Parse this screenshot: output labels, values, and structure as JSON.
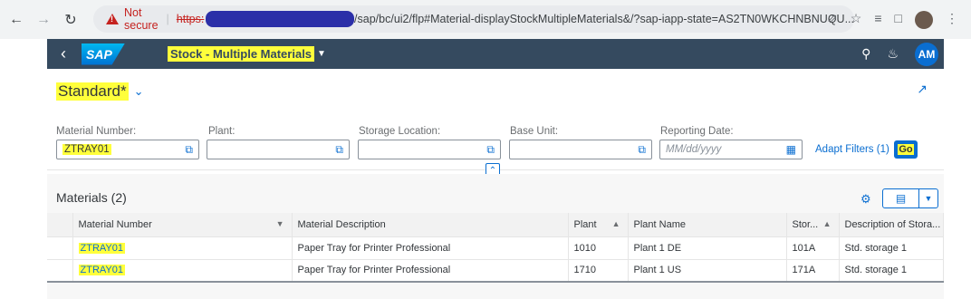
{
  "browser": {
    "security_label": "Not secure",
    "scheme_text": "https:",
    "url_rest": "/sap/bc/ui2/flp#Material-displayStockMultipleMaterials&/?sap-iapp-state=AS2TN0WKCHNBNUQU..."
  },
  "shell": {
    "app_title": "Stock - Multiple Materials",
    "logo_text": "SAP",
    "avatar_initials": "AM"
  },
  "filter": {
    "variant_name": "Standard*",
    "fields": [
      {
        "label": "Material Number:",
        "value": "ZTRAY01",
        "placeholder": ""
      },
      {
        "label": "Plant:",
        "value": "",
        "placeholder": ""
      },
      {
        "label": "Storage Location:",
        "value": "",
        "placeholder": ""
      },
      {
        "label": "Base Unit:",
        "value": "",
        "placeholder": ""
      },
      {
        "label": "Reporting Date:",
        "value": "",
        "placeholder": "MM/dd/yyyy"
      }
    ],
    "adapt_filters_label": "Adapt Filters (1)",
    "go_label": "Go"
  },
  "table": {
    "title": "Materials (2)",
    "columns": [
      "Material Number",
      "Material Description",
      "Plant",
      "Plant Name",
      "Stor...",
      "Description of Stora..."
    ],
    "rows": [
      [
        "ZTRAY01",
        "Paper Tray for Printer Professional",
        "1010",
        "Plant 1 DE",
        "101A",
        "Std. storage 1"
      ],
      [
        "ZTRAY01",
        "Paper Tray for Printer Professional",
        "1710",
        "Plant 1 US",
        "171A",
        "Std. storage 1"
      ]
    ]
  },
  "colors": {
    "shell": "#354a5f",
    "accent": "#0a6ed1",
    "highlight": "#ffff3b"
  }
}
